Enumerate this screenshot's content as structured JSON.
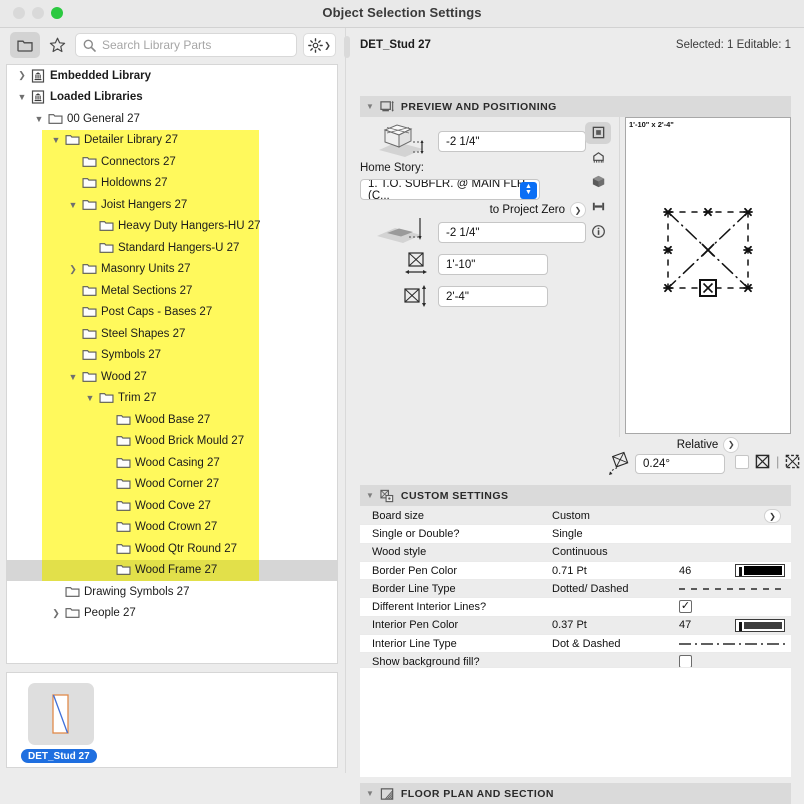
{
  "window": {
    "title": "Object Selection Settings",
    "traffic_lights": [
      "close",
      "minimize",
      "zoom"
    ]
  },
  "library_toolbar": {
    "folder_button": "folder-view",
    "favorites_button": "favorites",
    "search": {
      "placeholder": "Search Library Parts",
      "value": "",
      "icon": "search-icon"
    },
    "settings_button": "gear-icon"
  },
  "tree": {
    "items": [
      {
        "label": "Embedded Library",
        "depth": 0,
        "twisty": "collapsed",
        "icon": "library-icon",
        "bold": true,
        "highlight": false,
        "selected": false
      },
      {
        "label": "Loaded Libraries",
        "depth": 0,
        "twisty": "expanded",
        "icon": "library-icon",
        "bold": true,
        "highlight": false,
        "selected": false
      },
      {
        "label": "00 General 27",
        "depth": 1,
        "twisty": "expanded",
        "icon": "folder-icon",
        "bold": false,
        "highlight": false,
        "selected": false
      },
      {
        "label": "Detailer Library 27",
        "depth": 2,
        "twisty": "expanded",
        "icon": "folder-icon",
        "bold": false,
        "highlight": true,
        "selected": false
      },
      {
        "label": "Connectors 27",
        "depth": 3,
        "twisty": "none",
        "icon": "folder-icon",
        "bold": false,
        "highlight": true,
        "selected": false
      },
      {
        "label": "Holdowns 27",
        "depth": 3,
        "twisty": "none",
        "icon": "folder-icon",
        "bold": false,
        "highlight": true,
        "selected": false
      },
      {
        "label": "Joist Hangers 27",
        "depth": 3,
        "twisty": "expanded",
        "icon": "folder-icon",
        "bold": false,
        "highlight": true,
        "selected": false
      },
      {
        "label": "Heavy Duty Hangers-HU 27",
        "depth": 4,
        "twisty": "none",
        "icon": "folder-icon",
        "bold": false,
        "highlight": true,
        "selected": false
      },
      {
        "label": "Standard Hangers-U 27",
        "depth": 4,
        "twisty": "none",
        "icon": "folder-icon",
        "bold": false,
        "highlight": true,
        "selected": false
      },
      {
        "label": "Masonry Units 27",
        "depth": 3,
        "twisty": "collapsed",
        "icon": "folder-icon",
        "bold": false,
        "highlight": true,
        "selected": false
      },
      {
        "label": "Metal Sections 27",
        "depth": 3,
        "twisty": "none",
        "icon": "folder-icon",
        "bold": false,
        "highlight": true,
        "selected": false
      },
      {
        "label": "Post Caps - Bases 27",
        "depth": 3,
        "twisty": "none",
        "icon": "folder-icon",
        "bold": false,
        "highlight": true,
        "selected": false
      },
      {
        "label": "Steel Shapes 27",
        "depth": 3,
        "twisty": "none",
        "icon": "folder-icon",
        "bold": false,
        "highlight": true,
        "selected": false
      },
      {
        "label": "Symbols 27",
        "depth": 3,
        "twisty": "none",
        "icon": "folder-icon",
        "bold": false,
        "highlight": true,
        "selected": false
      },
      {
        "label": "Wood 27",
        "depth": 3,
        "twisty": "expanded",
        "icon": "folder-icon",
        "bold": false,
        "highlight": true,
        "selected": false
      },
      {
        "label": "Trim 27",
        "depth": 4,
        "twisty": "expanded",
        "icon": "folder-icon",
        "bold": false,
        "highlight": true,
        "selected": false
      },
      {
        "label": "Wood Base 27",
        "depth": 5,
        "twisty": "none",
        "icon": "folder-icon",
        "bold": false,
        "highlight": true,
        "selected": false
      },
      {
        "label": "Wood Brick Mould 27",
        "depth": 5,
        "twisty": "none",
        "icon": "folder-icon",
        "bold": false,
        "highlight": true,
        "selected": false
      },
      {
        "label": "Wood Casing 27",
        "depth": 5,
        "twisty": "none",
        "icon": "folder-icon",
        "bold": false,
        "highlight": true,
        "selected": false
      },
      {
        "label": "Wood Corner 27",
        "depth": 5,
        "twisty": "none",
        "icon": "folder-icon",
        "bold": false,
        "highlight": true,
        "selected": false
      },
      {
        "label": "Wood Cove 27",
        "depth": 5,
        "twisty": "none",
        "icon": "folder-icon",
        "bold": false,
        "highlight": true,
        "selected": false
      },
      {
        "label": "Wood Crown 27",
        "depth": 5,
        "twisty": "none",
        "icon": "folder-icon",
        "bold": false,
        "highlight": true,
        "selected": false
      },
      {
        "label": "Wood Qtr Round 27",
        "depth": 5,
        "twisty": "none",
        "icon": "folder-icon",
        "bold": false,
        "highlight": true,
        "selected": false
      },
      {
        "label": "Wood Frame 27",
        "depth": 5,
        "twisty": "none",
        "icon": "folder-icon",
        "bold": false,
        "highlight": true,
        "selected": true
      },
      {
        "label": "Drawing Symbols 27",
        "depth": 2,
        "twisty": "none",
        "icon": "folder-icon",
        "bold": false,
        "highlight": false,
        "selected": false
      },
      {
        "label": "People 27",
        "depth": 2,
        "twisty": "collapsed",
        "icon": "folder-icon",
        "bold": false,
        "highlight": false,
        "selected": false
      }
    ],
    "highlight_color": "#fff95c",
    "selection_color": "#d6d6d6"
  },
  "thumbnail_panel": {
    "item_label": "DET_Stud 27",
    "badge_color": "#1f6fe0"
  },
  "object_header": {
    "name": "DET_Stud 27",
    "status": "Selected: 1 Editable: 1"
  },
  "preview_section": {
    "title": "PREVIEW AND POSITIONING",
    "icon": "preview-positioning-icon",
    "expanded": true,
    "elevation_top_value": "-2 1/4\"",
    "home_story_label": "Home Story:",
    "home_story_value": "1. T.O. SUBFLR. @ MAIN FLR. (C...",
    "to_project_zero_label": "to Project Zero",
    "elevation_project_value": "-2 1/4\"",
    "width_value": "1'-10\"",
    "height_value": "2'-4\"",
    "preview_dimension_label": "1'-10\" x 2'-4\"",
    "relative_label": "Relative",
    "angle_value": "0.24°",
    "view_buttons": [
      "2d-symbol-icon",
      "elevation-icon",
      "3d-cube-icon",
      "section-icon",
      "info-icon"
    ],
    "active_view": "2d-symbol-icon"
  },
  "custom_settings": {
    "title": "CUSTOM SETTINGS",
    "icon": "custom-settings-icon",
    "expanded": true,
    "rows": [
      {
        "name": "Board size",
        "value": "Custom",
        "num": "",
        "control": "chevron"
      },
      {
        "name": "Single or Double?",
        "value": "Single",
        "num": "",
        "control": "none"
      },
      {
        "name": "Wood style",
        "value": "Continuous",
        "num": "",
        "control": "none"
      },
      {
        "name": "Border Pen Color",
        "value": "0.71 Pt",
        "num": "46",
        "control": "swatch",
        "swatch_color": "#000000",
        "swatch_weight": 9
      },
      {
        "name": "Border Line Type",
        "value": "Dotted/ Dashed",
        "num": "",
        "control": "line-dashed"
      },
      {
        "name": "Different Interior Lines?",
        "value": "",
        "num": "",
        "control": "checkbox",
        "checked": true
      },
      {
        "name": "Interior Pen Color",
        "value": "0.37 Pt",
        "num": "47",
        "control": "swatch",
        "swatch_color": "#3d3d3d",
        "swatch_weight": 7
      },
      {
        "name": "Interior Line Type",
        "value": "Dot & Dashed",
        "num": "",
        "control": "line-dotdash"
      },
      {
        "name": "Show background fill?",
        "value": "",
        "num": "",
        "control": "checkbox",
        "checked": false
      }
    ]
  },
  "floor_plan_section": {
    "title": "FLOOR PLAN AND SECTION",
    "icon": "floor-plan-icon",
    "expanded": true
  }
}
